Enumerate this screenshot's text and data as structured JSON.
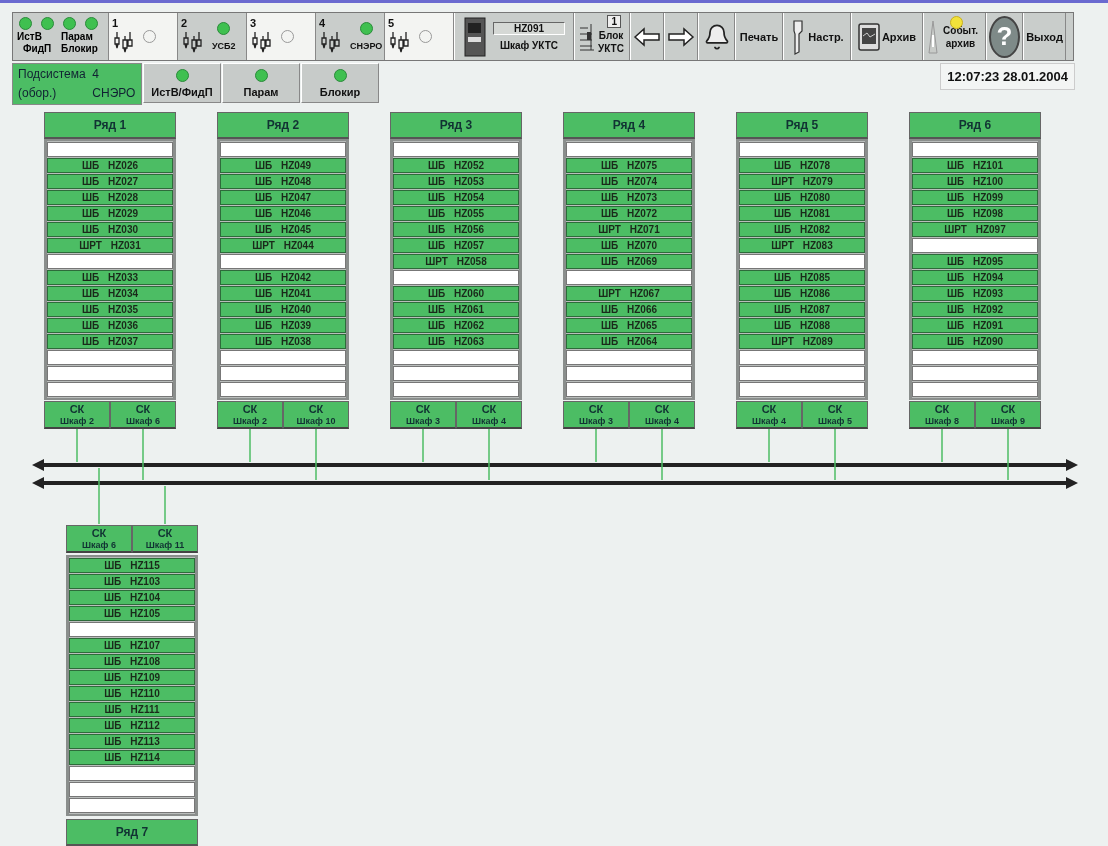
{
  "toolbar": {
    "indicators": [
      {
        "label": "ИстВ",
        "on": true
      },
      {
        "label": "Парам",
        "on": true
      },
      {
        "label": "ФидП",
        "on": true
      },
      {
        "label": "Блокир",
        "on": true
      }
    ],
    "subsystems": [
      {
        "number": "1",
        "on": false
      },
      {
        "number": "2",
        "label": "УСБ2",
        "on": true
      },
      {
        "number": "3",
        "on": false
      },
      {
        "number": "4",
        "label": "СНЭРО",
        "on": true
      },
      {
        "number": "5",
        "on": false
      }
    ],
    "cabinet": {
      "code": "HZ091",
      "label": "Шкаф УКТС"
    },
    "block": {
      "number": "1",
      "label": "Блок УКТС"
    },
    "buttons": [
      {
        "kind": "back"
      },
      {
        "kind": "forward"
      },
      {
        "kind": "alarm"
      },
      {
        "kind": "print",
        "label": "Печать"
      },
      {
        "kind": "settings",
        "label": "Настр."
      },
      {
        "kind": "archive",
        "label": "Архив"
      },
      {
        "kind": "events",
        "label": "Событ. архив",
        "on": true
      },
      {
        "kind": "help",
        "label": "?"
      },
      {
        "kind": "exit",
        "label": "Выход"
      }
    ]
  },
  "subsystem_panel": {
    "title": "Подсистема",
    "number": "4",
    "note": "(обор.)",
    "name": "СНЭРО"
  },
  "tabs": [
    {
      "label": "ИстВ/ФидП",
      "on": true
    },
    {
      "label": "Парам",
      "on": true
    },
    {
      "label": "Блокир",
      "on": true
    }
  ],
  "clock": "12:07:23 28.01.2004",
  "racks": [
    {
      "title": "Ряд 1",
      "slots": [
        {
          "kind": "empty"
        },
        {
          "kind": "cabinet",
          "label": "ШБ HZ026"
        },
        {
          "kind": "cabinet",
          "label": "ШБ HZ027"
        },
        {
          "kind": "cabinet",
          "label": "ШБ HZ028"
        },
        {
          "kind": "cabinet",
          "label": "ШБ HZ029"
        },
        {
          "kind": "cabinet",
          "label": "ШБ HZ030"
        },
        {
          "kind": "cabinet",
          "label": "ШРТ HZ031"
        },
        {
          "kind": "empty"
        },
        {
          "kind": "cabinet",
          "label": "ШБ HZ033"
        },
        {
          "kind": "cabinet",
          "label": "ШБ HZ034"
        },
        {
          "kind": "cabinet",
          "label": "ШБ HZ035"
        },
        {
          "kind": "cabinet",
          "label": "ШБ HZ036"
        },
        {
          "kind": "cabinet",
          "label": "ШБ HZ037"
        },
        {
          "kind": "empty"
        },
        {
          "kind": "empty"
        },
        {
          "kind": "empty"
        }
      ],
      "nodes": [
        {
          "title": "СК",
          "label": "Шкаф 2",
          "lower_bus": false
        },
        {
          "title": "СК",
          "label": "Шкаф 6",
          "lower_bus": true
        }
      ]
    },
    {
      "title": "Ряд 2",
      "slots": [
        {
          "kind": "empty"
        },
        {
          "kind": "cabinet",
          "label": "ШБ HZ049"
        },
        {
          "kind": "cabinet",
          "label": "ШБ HZ048"
        },
        {
          "kind": "cabinet",
          "label": "ШБ HZ047"
        },
        {
          "kind": "cabinet",
          "label": "ШБ HZ046"
        },
        {
          "kind": "cabinet",
          "label": "ШБ HZ045"
        },
        {
          "kind": "cabinet",
          "label": "ШРТ HZ044"
        },
        {
          "kind": "empty"
        },
        {
          "kind": "cabinet",
          "label": "ШБ HZ042"
        },
        {
          "kind": "cabinet",
          "label": "ШБ HZ041"
        },
        {
          "kind": "cabinet",
          "label": "ШБ HZ040"
        },
        {
          "kind": "cabinet",
          "label": "ШБ HZ039"
        },
        {
          "kind": "cabinet",
          "label": "ШБ HZ038"
        },
        {
          "kind": "empty"
        },
        {
          "kind": "empty"
        },
        {
          "kind": "empty"
        }
      ],
      "nodes": [
        {
          "title": "СК",
          "label": "Шкаф 2",
          "lower_bus": false
        },
        {
          "title": "СК",
          "label": "Шкаф 10",
          "lower_bus": true
        }
      ]
    },
    {
      "title": "Ряд 3",
      "slots": [
        {
          "kind": "empty"
        },
        {
          "kind": "cabinet",
          "label": "ШБ HZ052"
        },
        {
          "kind": "cabinet",
          "label": "ШБ HZ053"
        },
        {
          "kind": "cabinet",
          "label": "ШБ HZ054"
        },
        {
          "kind": "cabinet",
          "label": "ШБ HZ055"
        },
        {
          "kind": "cabinet",
          "label": "ШБ HZ056"
        },
        {
          "kind": "cabinet",
          "label": "ШБ HZ057"
        },
        {
          "kind": "cabinet",
          "label": "ШРТ HZ058"
        },
        {
          "kind": "empty"
        },
        {
          "kind": "cabinet",
          "label": "ШБ HZ060"
        },
        {
          "kind": "cabinet",
          "label": "ШБ HZ061"
        },
        {
          "kind": "cabinet",
          "label": "ШБ HZ062"
        },
        {
          "kind": "cabinet",
          "label": "ШБ HZ063"
        },
        {
          "kind": "empty"
        },
        {
          "kind": "empty"
        },
        {
          "kind": "empty"
        }
      ],
      "nodes": [
        {
          "title": "СК",
          "label": "Шкаф 3",
          "lower_bus": false
        },
        {
          "title": "СК",
          "label": "Шкаф 4",
          "lower_bus": true
        }
      ]
    },
    {
      "title": "Ряд 4",
      "slots": [
        {
          "kind": "empty"
        },
        {
          "kind": "cabinet",
          "label": "ШБ HZ075"
        },
        {
          "kind": "cabinet",
          "label": "ШБ HZ074"
        },
        {
          "kind": "cabinet",
          "label": "ШБ HZ073"
        },
        {
          "kind": "cabinet",
          "label": "ШБ HZ072"
        },
        {
          "kind": "cabinet",
          "label": "ШРТ HZ071"
        },
        {
          "kind": "cabinet",
          "label": "ШБ HZ070"
        },
        {
          "kind": "cabinet",
          "label": "ШБ HZ069"
        },
        {
          "kind": "empty"
        },
        {
          "kind": "cabinet",
          "label": "ШРТ HZ067"
        },
        {
          "kind": "cabinet",
          "label": "ШБ HZ066"
        },
        {
          "kind": "cabinet",
          "label": "ШБ HZ065"
        },
        {
          "kind": "cabinet",
          "label": "ШБ HZ064"
        },
        {
          "kind": "empty"
        },
        {
          "kind": "empty"
        },
        {
          "kind": "empty"
        }
      ],
      "nodes": [
        {
          "title": "СК",
          "label": "Шкаф 3",
          "lower_bus": false
        },
        {
          "title": "СК",
          "label": "Шкаф 4",
          "lower_bus": true
        }
      ]
    },
    {
      "title": "Ряд 5",
      "slots": [
        {
          "kind": "empty"
        },
        {
          "kind": "cabinet",
          "label": "ШБ HZ078"
        },
        {
          "kind": "cabinet",
          "label": "ШРТ HZ079"
        },
        {
          "kind": "cabinet",
          "label": "ШБ HZ080"
        },
        {
          "kind": "cabinet",
          "label": "ШБ HZ081"
        },
        {
          "kind": "cabinet",
          "label": "ШБ HZ082"
        },
        {
          "kind": "cabinet",
          "label": "ШРТ HZ083"
        },
        {
          "kind": "empty"
        },
        {
          "kind": "cabinet",
          "label": "ШБ HZ085"
        },
        {
          "kind": "cabinet",
          "label": "ШБ HZ086"
        },
        {
          "kind": "cabinet",
          "label": "ШБ HZ087"
        },
        {
          "kind": "cabinet",
          "label": "ШБ HZ088"
        },
        {
          "kind": "cabinet",
          "label": "ШРТ HZ089"
        },
        {
          "kind": "empty"
        },
        {
          "kind": "empty"
        },
        {
          "kind": "empty"
        }
      ],
      "nodes": [
        {
          "title": "СК",
          "label": "Шкаф 4",
          "lower_bus": false
        },
        {
          "title": "СК",
          "label": "Шкаф 5",
          "lower_bus": true
        }
      ]
    },
    {
      "title": "Ряд 6",
      "slots": [
        {
          "kind": "empty"
        },
        {
          "kind": "cabinet",
          "label": "ШБ HZ101"
        },
        {
          "kind": "cabinet",
          "label": "ШБ HZ100"
        },
        {
          "kind": "cabinet",
          "label": "ШБ HZ099"
        },
        {
          "kind": "cabinet",
          "label": "ШБ HZ098"
        },
        {
          "kind": "cabinet",
          "label": "ШРТ HZ097"
        },
        {
          "kind": "empty"
        },
        {
          "kind": "cabinet",
          "label": "ШБ HZ095"
        },
        {
          "kind": "cabinet",
          "label": "ШБ HZ094"
        },
        {
          "kind": "cabinet",
          "label": "ШБ HZ093"
        },
        {
          "kind": "cabinet",
          "label": "ШБ HZ092"
        },
        {
          "kind": "cabinet",
          "label": "ШБ HZ091"
        },
        {
          "kind": "cabinet",
          "label": "ШБ HZ090"
        },
        {
          "kind": "empty"
        },
        {
          "kind": "empty"
        },
        {
          "kind": "empty"
        }
      ],
      "nodes": [
        {
          "title": "СК",
          "label": "Шкаф 8",
          "lower_bus": false
        },
        {
          "title": "СК",
          "label": "Шкаф 9",
          "lower_bus": true
        }
      ]
    }
  ],
  "bottom_rack": {
    "title": "Ряд 7",
    "slots": [
      {
        "kind": "cabinet",
        "label": "ШБ HZ115"
      },
      {
        "kind": "cabinet",
        "label": "ШБ HZ103"
      },
      {
        "kind": "cabinet",
        "label": "ШБ HZ104"
      },
      {
        "kind": "cabinet",
        "label": "ШБ HZ105"
      },
      {
        "kind": "empty"
      },
      {
        "kind": "cabinet",
        "label": "ШБ HZ107"
      },
      {
        "kind": "cabinet",
        "label": "ШБ HZ108"
      },
      {
        "kind": "cabinet",
        "label": "ШБ HZ109"
      },
      {
        "kind": "cabinet",
        "label": "ШБ HZ110"
      },
      {
        "kind": "cabinet",
        "label": "ШБ HZ111"
      },
      {
        "kind": "cabinet",
        "label": "ШБ HZ112"
      },
      {
        "kind": "cabinet",
        "label": "ШБ HZ113"
      },
      {
        "kind": "cabinet",
        "label": "ШБ HZ114"
      },
      {
        "kind": "empty"
      },
      {
        "kind": "empty"
      },
      {
        "kind": "empty"
      }
    ],
    "nodes": [
      {
        "title": "СК",
        "label": "Шкаф 6",
        "lower_bus": false
      },
      {
        "title": "СК",
        "label": "Шкаф 11",
        "lower_bus": true
      }
    ]
  }
}
